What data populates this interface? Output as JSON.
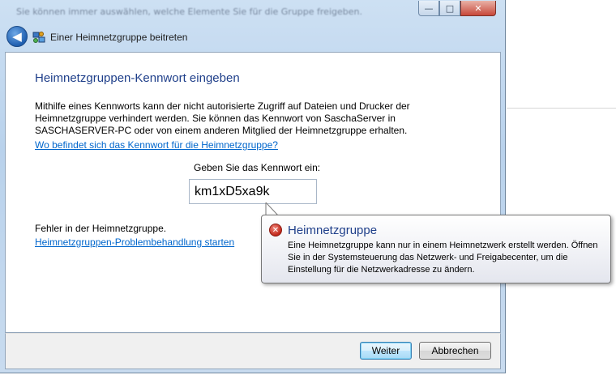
{
  "background_window": {
    "blurred_text": "Sie können immer auswählen, welche Elemente Sie für die Gruppe freigeben."
  },
  "window": {
    "title": "Einer Heimnetzgruppe beitreten",
    "controls": {
      "minimize_glyph": "—",
      "maximize_glyph": "□",
      "close_glyph": "✕"
    },
    "back_glyph": "◀"
  },
  "main": {
    "heading": "Heimnetzgruppen-Kennwort eingeben",
    "description": "Mithilfe eines Kennworts kann der nicht autorisierte Zugriff auf Dateien und Drucker der Heimnetzgruppe verhindert werden. Sie können das Kennwort von SaschaServer in SASCHASERVER-PC oder von einem anderen Mitglied der Heimnetzgruppe erhalten.",
    "where_link": "Wo befindet sich das Kennwort für die Heimnetzgruppe?",
    "password_label": "Geben Sie das Kennwort ein:",
    "password_value": "km1xD5xa9k",
    "error_text": "Fehler in der Heimnetzgruppe.",
    "troubleshoot_link": "Heimnetzgruppen-Problembehandlung starten"
  },
  "tooltip": {
    "icon": "error-icon",
    "icon_glyph": "✕",
    "title": "Heimnetzgruppe",
    "body": "Eine Heimnetzgruppe kann nur in einem Heimnetzwerk erstellt werden. Öffnen Sie in der Systemsteuerung das Netzwerk- und Freigabecenter, um die Einstellung für die Netzwerkadresse zu ändern."
  },
  "footer": {
    "next_label": "Weiter",
    "cancel_label": "Abbrechen"
  },
  "colors": {
    "heading": "#1f3f8a",
    "link": "#0066cc",
    "error_red": "#c0271a"
  }
}
